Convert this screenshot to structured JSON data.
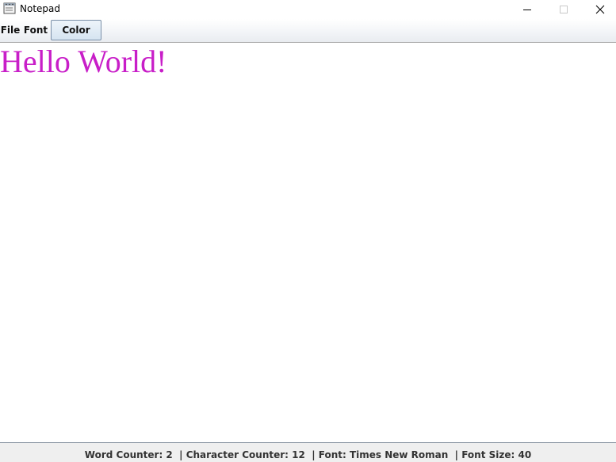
{
  "window": {
    "title": "Notepad",
    "icon": "notepad-app-icon",
    "controls": [
      "minimize-icon",
      "maximize-icon",
      "close-icon"
    ]
  },
  "menubar": {
    "file_label": "File",
    "font_label": "Font",
    "color_label": "Color"
  },
  "editor": {
    "content": "Hello World!",
    "text_color": "#c81ec8"
  },
  "statusbar": {
    "text": "Word Counter: 2  | Character Counter: 12  | Font: Times New Roman  | Font Size: 40"
  }
}
